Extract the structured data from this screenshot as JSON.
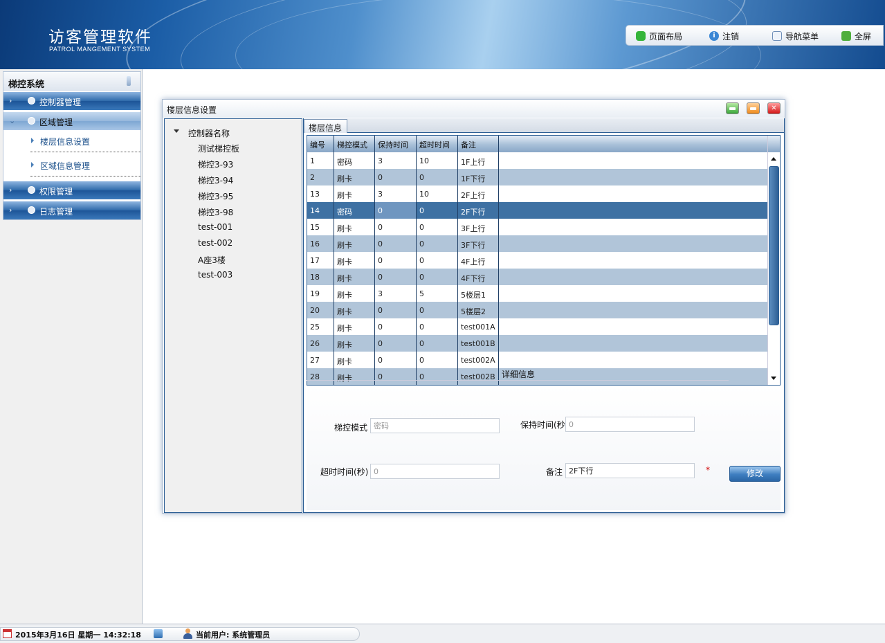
{
  "header": {
    "title": "访客管理软件",
    "subtitle": "PATROL MANGEMENT SYSTEM",
    "buttons": {
      "layout": "页面布局",
      "logout": "注销",
      "nav_menu": "导航菜单",
      "fullscreen": "全屏"
    }
  },
  "sidebar": {
    "title": "梯控系统",
    "groups": {
      "controller": "控制器管理",
      "area": "区域管理",
      "permission": "权限管理",
      "log": "日志管理"
    },
    "area_items": [
      "楼层信息设置",
      "区域信息管理"
    ]
  },
  "window": {
    "title": "楼层信息设置",
    "tree": {
      "root": "控制器名称",
      "items": [
        "测试梯控板",
        "梯控3-93",
        "梯控3-94",
        "梯控3-95",
        "梯控3-98",
        "test-001",
        "test-002",
        "A座3楼",
        "test-003"
      ]
    },
    "tab": "楼层信息",
    "grid": {
      "headers": [
        "编号",
        "梯控模式",
        "保持时间",
        "超时时间",
        "备注"
      ],
      "rows": [
        [
          "1",
          "密码",
          "3",
          "10",
          "1F上行"
        ],
        [
          "2",
          "刷卡",
          "0",
          "0",
          "1F下行"
        ],
        [
          "13",
          "刷卡",
          "3",
          "10",
          "2F上行"
        ],
        [
          "14",
          "密码",
          "0",
          "0",
          "2F下行"
        ],
        [
          "15",
          "刷卡",
          "0",
          "0",
          "3F上行"
        ],
        [
          "16",
          "刷卡",
          "0",
          "0",
          "3F下行"
        ],
        [
          "17",
          "刷卡",
          "0",
          "0",
          "4F上行"
        ],
        [
          "18",
          "刷卡",
          "0",
          "0",
          "4F下行"
        ],
        [
          "19",
          "刷卡",
          "3",
          "5",
          "5楼层1"
        ],
        [
          "20",
          "刷卡",
          "0",
          "0",
          "5楼层2"
        ],
        [
          "25",
          "刷卡",
          "0",
          "0",
          "test001A"
        ],
        [
          "26",
          "刷卡",
          "0",
          "0",
          "test001B"
        ],
        [
          "27",
          "刷卡",
          "0",
          "0",
          "test002A"
        ],
        [
          "28",
          "刷卡",
          "0",
          "0",
          "test002B"
        ]
      ]
    },
    "detail": {
      "caption": "详细信息",
      "mode_label": "梯控模式",
      "mode_value": "密码",
      "hold_label": "保持时间(秒)",
      "hold_value": "0",
      "timeout_label": "超时时间(秒)",
      "timeout_value": "0",
      "remark_label": "备注",
      "remark_value": "2F下行",
      "required_mark": "*",
      "modify_button": "修改"
    }
  },
  "status": {
    "datetime": "2015年3月16日 星期一 14:32:18",
    "user": "当前用户: 系统管理员"
  },
  "colors": {
    "header_blue": "#1b5da6",
    "row_alt": "#b1c5d9",
    "row_selected": "#3e71a3"
  }
}
